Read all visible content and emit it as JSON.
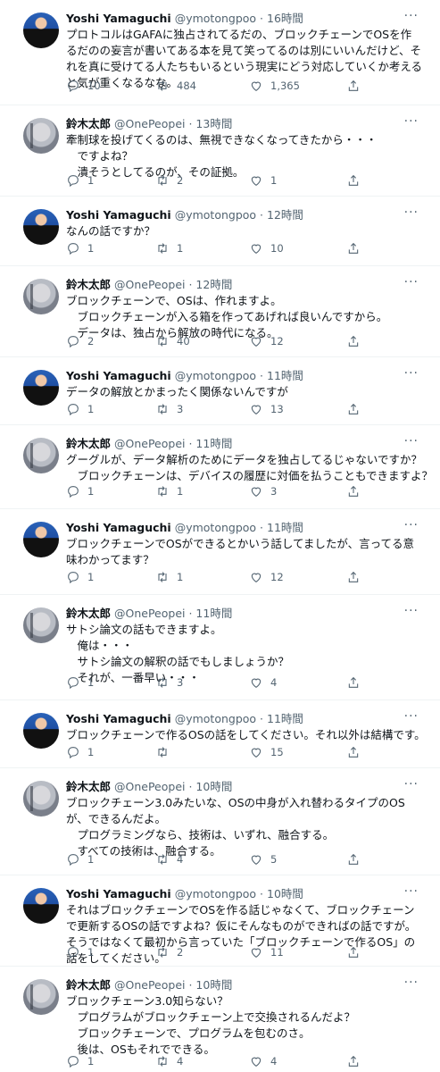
{
  "tweets": [
    {
      "author": "yoshi",
      "name": "Yoshi Yamaguchi",
      "handle": "@ymotongpoo",
      "time": "16時間",
      "lines": [
        "プロトコルはGAFAに独占されてるだの、ブロックチェーンでOSを作るだのの妄言が書いてある本を見て笑ってるのは別にいいんだけど、それを真に受けてる人たちもいるという現実にどう対応していくか考えると気が重くなるなな。"
      ],
      "replies": "10",
      "retweets": "484",
      "likes": "1,365"
    },
    {
      "author": "suzuki",
      "name": "鈴木太郎",
      "handle": "@OnePeopei",
      "time": "13時間",
      "lines": [
        "牽制球を投げてくるのは、無視できなくなってきたから・・・",
        "　ですよね？",
        "　潰そうとしてるのが、その証拠。"
      ],
      "replies": "1",
      "retweets": "2",
      "likes": "1"
    },
    {
      "author": "yoshi",
      "name": "Yoshi Yamaguchi",
      "handle": "@ymotongpoo",
      "time": "12時間",
      "lines": [
        "なんの話ですか？"
      ],
      "replies": "1",
      "retweets": "1",
      "likes": "10"
    },
    {
      "author": "suzuki",
      "name": "鈴木太郎",
      "handle": "@OnePeopei",
      "time": "12時間",
      "lines": [
        "ブロックチェーンで、OSは、作れますよ。",
        "　ブロックチェーンが入る箱を作ってあげれば良いんですから。",
        "　データは、独占から解放の時代になる。"
      ],
      "replies": "2",
      "retweets": "40",
      "likes": "12"
    },
    {
      "author": "yoshi",
      "name": "Yoshi Yamaguchi",
      "handle": "@ymotongpoo",
      "time": "11時間",
      "lines": [
        "データの解放とかまったく関係ないんですが"
      ],
      "replies": "1",
      "retweets": "3",
      "likes": "13"
    },
    {
      "author": "suzuki",
      "name": "鈴木太郎",
      "handle": "@OnePeopei",
      "time": "11時間",
      "lines": [
        "グーグルが、データ解析のためにデータを独占してるじゃないですか？",
        "　ブロックチェーンは、デバイスの履歴に対価を払うこともできますよ？"
      ],
      "replies": "1",
      "retweets": "1",
      "likes": "3"
    },
    {
      "author": "yoshi",
      "name": "Yoshi Yamaguchi",
      "handle": "@ymotongpoo",
      "time": "11時間",
      "lines": [
        "ブロックチェーンでOSができるとかいう話してましたが、言ってる意味わかってます？"
      ],
      "replies": "1",
      "retweets": "1",
      "likes": "12"
    },
    {
      "author": "suzuki",
      "name": "鈴木太郎",
      "handle": "@OnePeopei",
      "time": "11時間",
      "lines": [
        "サトシ論文の話もできますよ。",
        "　俺は・・・",
        "　サトシ論文の解釈の話でもしましょうか？",
        "　それが、一番早い・・・"
      ],
      "replies": "1",
      "retweets": "3",
      "likes": "4"
    },
    {
      "author": "yoshi",
      "name": "Yoshi Yamaguchi",
      "handle": "@ymotongpoo",
      "time": "11時間",
      "lines": [
        "ブロックチェーンで作るOSの話をしてください。それ以外は結構です。"
      ],
      "replies": "1",
      "retweets": "",
      "likes": "15"
    },
    {
      "author": "suzuki",
      "name": "鈴木太郎",
      "handle": "@OnePeopei",
      "time": "10時間",
      "lines": [
        "ブロックチェーン3.0みたいな、OSの中身が入れ替わるタイプのOSが、できるんだよ。",
        "　プログラミングなら、技術は、いずれ、融合する。",
        "　すべての技術は、融合する。"
      ],
      "replies": "1",
      "retweets": "4",
      "likes": "5"
    },
    {
      "author": "yoshi",
      "name": "Yoshi Yamaguchi",
      "handle": "@ymotongpoo",
      "time": "10時間",
      "lines": [
        "それはブロックチェーンでOSを作る話じゃなくて、ブロックチェーンで更新するOSの話ですよね？仮にそんなものができればの話ですが。そうではなくて最初から言っていた「ブロックチェーンで作るOS」の話をしてください。"
      ],
      "replies": "1",
      "retweets": "2",
      "likes": "11"
    },
    {
      "author": "suzuki",
      "name": "鈴木太郎",
      "handle": "@OnePeopei",
      "time": "10時間",
      "lines": [
        "ブロックチェーン3.0知らない？",
        "　プログラムがブロックチェーン上で交換されるんだよ？",
        "　ブロックチェーンで、プログラムを包むのさ。",
        "　後は、OSもそれでできる。"
      ],
      "replies": "1",
      "retweets": "4",
      "likes": "4"
    }
  ],
  "more_glyph": "···"
}
